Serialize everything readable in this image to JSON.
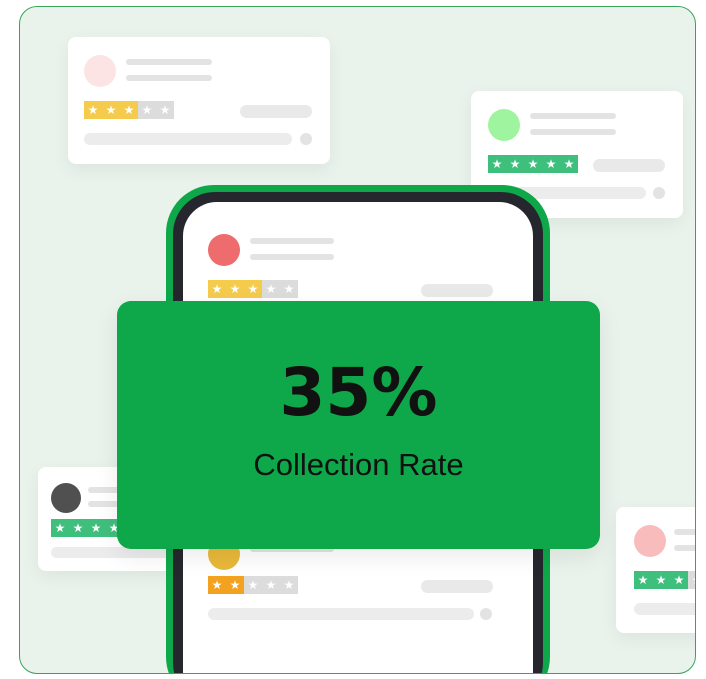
{
  "stat": {
    "value": "35%",
    "label": "Collection Rate"
  },
  "colors": {
    "brand_green": "#0ea84a",
    "background": "#e9f3ec",
    "phone_bezel": "#26272e",
    "yellow_star": "#f4cb4d",
    "green_star": "#3fbf7c",
    "orange_star": "#f3a21f"
  },
  "review_cards": [
    {
      "position": "top-left",
      "avatar_color": "#fde4e4",
      "rating": 3,
      "max_rating": 5,
      "star_color": "#f4cb4d"
    },
    {
      "position": "top-right",
      "avatar_color": "#9ff59f",
      "rating": 5,
      "max_rating": 5,
      "star_color": "#3fbf7c"
    },
    {
      "position": "phone-top",
      "avatar_color": "#ee6b6e",
      "rating": 3,
      "max_rating": 5,
      "star_color": "#f4cb4d"
    },
    {
      "position": "phone-bottom",
      "avatar_color": "#e9b93a",
      "rating": 2,
      "max_rating": 5,
      "star_color": "#f3a21f"
    },
    {
      "position": "bottom-left",
      "avatar_color": "#505050",
      "rating": 4,
      "max_rating": 5,
      "star_color": "#3fbf7c"
    },
    {
      "position": "bottom-right",
      "avatar_color": "#f9bcbc",
      "rating": 3,
      "max_rating": 5,
      "star_color": "#3fbf7c"
    }
  ]
}
